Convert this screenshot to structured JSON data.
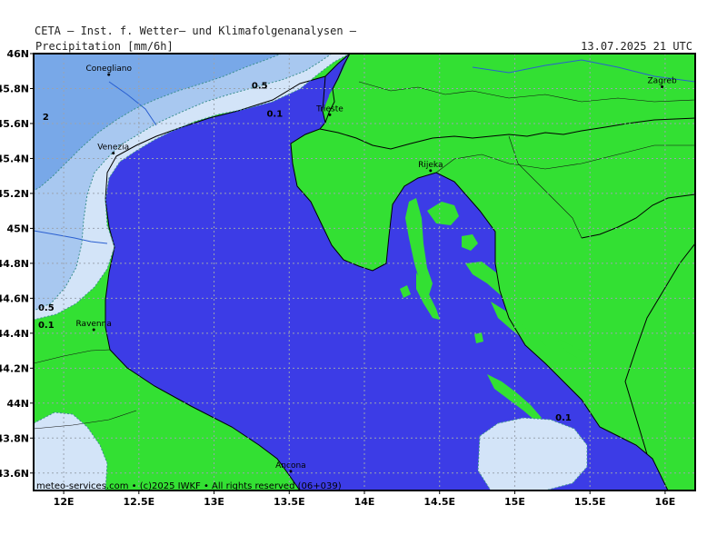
{
  "header": {
    "title": "CETA — Inst. f. Wetter— und Klimafolgenanalysen —",
    "variable": "Precipitation [mm/6h]",
    "datetime": "13.07.2025 21 UTC"
  },
  "footer": "meteo-services.com • (c)2025 IWKF • All rights reserved (06+039)",
  "axes": {
    "lat_labels": [
      "46N",
      "45.8N",
      "45.6N",
      "45.4N",
      "45.2N",
      "45N",
      "44.8N",
      "44.6N",
      "44.4N",
      "44.2N",
      "44N",
      "43.8N",
      "43.6N"
    ],
    "lon_labels": [
      "12E",
      "12.5E",
      "13E",
      "13.5E",
      "14E",
      "14.5E",
      "15E",
      "15.5E",
      "16E"
    ],
    "lat_range": [
      43.5,
      46.0
    ],
    "lon_range": [
      11.8,
      16.2
    ],
    "grid": true
  },
  "cities": [
    {
      "name": "Conegliano",
      "lon": 12.3,
      "lat": 45.88
    },
    {
      "name": "Venezia",
      "lon": 12.33,
      "lat": 45.43
    },
    {
      "name": "Trieste",
      "lon": 13.77,
      "lat": 45.65
    },
    {
      "name": "Zagreb",
      "lon": 15.98,
      "lat": 45.81
    },
    {
      "name": "Rijeka",
      "lon": 14.44,
      "lat": 45.33
    },
    {
      "name": "Ravenna",
      "lon": 12.2,
      "lat": 44.42
    },
    {
      "name": "Ancona",
      "lon": 13.51,
      "lat": 43.61
    }
  ],
  "contour_labels": [
    {
      "text": "0.5",
      "lon": 13.25,
      "lat": 45.8
    },
    {
      "text": "0.1",
      "lon": 13.35,
      "lat": 45.64
    },
    {
      "text": "2",
      "lon": 11.86,
      "lat": 45.62
    },
    {
      "text": "0.5",
      "lon": 11.83,
      "lat": 44.53
    },
    {
      "text": "0.1",
      "lon": 11.83,
      "lat": 44.43
    },
    {
      "text": "0.1",
      "lon": 15.27,
      "lat": 43.9
    }
  ],
  "colors": {
    "sea": "#3c3ce6",
    "land": "#33e033",
    "precip_0_1": "#d3e4f8",
    "precip_0_5": "#a8c8f0",
    "precip_2": "#78a8e8",
    "border": "#000000",
    "river": "#2a5fd0",
    "grid": "#9aa3b0"
  }
}
